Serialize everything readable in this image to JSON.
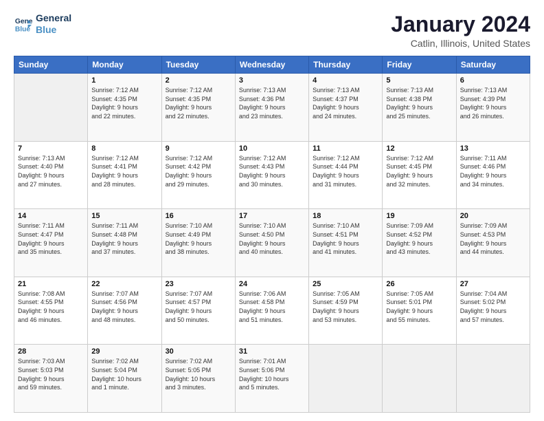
{
  "logo": {
    "line1": "General",
    "line2": "Blue"
  },
  "header": {
    "title": "January 2024",
    "subtitle": "Catlin, Illinois, United States"
  },
  "weekdays": [
    "Sunday",
    "Monday",
    "Tuesday",
    "Wednesday",
    "Thursday",
    "Friday",
    "Saturday"
  ],
  "weeks": [
    [
      {
        "day": "",
        "info": ""
      },
      {
        "day": "1",
        "info": "Sunrise: 7:12 AM\nSunset: 4:35 PM\nDaylight: 9 hours\nand 22 minutes."
      },
      {
        "day": "2",
        "info": "Sunrise: 7:12 AM\nSunset: 4:35 PM\nDaylight: 9 hours\nand 22 minutes."
      },
      {
        "day": "3",
        "info": "Sunrise: 7:13 AM\nSunset: 4:36 PM\nDaylight: 9 hours\nand 23 minutes."
      },
      {
        "day": "4",
        "info": "Sunrise: 7:13 AM\nSunset: 4:37 PM\nDaylight: 9 hours\nand 24 minutes."
      },
      {
        "day": "5",
        "info": "Sunrise: 7:13 AM\nSunset: 4:38 PM\nDaylight: 9 hours\nand 25 minutes."
      },
      {
        "day": "6",
        "info": "Sunrise: 7:13 AM\nSunset: 4:39 PM\nDaylight: 9 hours\nand 26 minutes."
      }
    ],
    [
      {
        "day": "7",
        "info": "Sunrise: 7:13 AM\nSunset: 4:40 PM\nDaylight: 9 hours\nand 27 minutes."
      },
      {
        "day": "8",
        "info": "Sunrise: 7:12 AM\nSunset: 4:41 PM\nDaylight: 9 hours\nand 28 minutes."
      },
      {
        "day": "9",
        "info": "Sunrise: 7:12 AM\nSunset: 4:42 PM\nDaylight: 9 hours\nand 29 minutes."
      },
      {
        "day": "10",
        "info": "Sunrise: 7:12 AM\nSunset: 4:43 PM\nDaylight: 9 hours\nand 30 minutes."
      },
      {
        "day": "11",
        "info": "Sunrise: 7:12 AM\nSunset: 4:44 PM\nDaylight: 9 hours\nand 31 minutes."
      },
      {
        "day": "12",
        "info": "Sunrise: 7:12 AM\nSunset: 4:45 PM\nDaylight: 9 hours\nand 32 minutes."
      },
      {
        "day": "13",
        "info": "Sunrise: 7:11 AM\nSunset: 4:46 PM\nDaylight: 9 hours\nand 34 minutes."
      }
    ],
    [
      {
        "day": "14",
        "info": "Sunrise: 7:11 AM\nSunset: 4:47 PM\nDaylight: 9 hours\nand 35 minutes."
      },
      {
        "day": "15",
        "info": "Sunrise: 7:11 AM\nSunset: 4:48 PM\nDaylight: 9 hours\nand 37 minutes."
      },
      {
        "day": "16",
        "info": "Sunrise: 7:10 AM\nSunset: 4:49 PM\nDaylight: 9 hours\nand 38 minutes."
      },
      {
        "day": "17",
        "info": "Sunrise: 7:10 AM\nSunset: 4:50 PM\nDaylight: 9 hours\nand 40 minutes."
      },
      {
        "day": "18",
        "info": "Sunrise: 7:10 AM\nSunset: 4:51 PM\nDaylight: 9 hours\nand 41 minutes."
      },
      {
        "day": "19",
        "info": "Sunrise: 7:09 AM\nSunset: 4:52 PM\nDaylight: 9 hours\nand 43 minutes."
      },
      {
        "day": "20",
        "info": "Sunrise: 7:09 AM\nSunset: 4:53 PM\nDaylight: 9 hours\nand 44 minutes."
      }
    ],
    [
      {
        "day": "21",
        "info": "Sunrise: 7:08 AM\nSunset: 4:55 PM\nDaylight: 9 hours\nand 46 minutes."
      },
      {
        "day": "22",
        "info": "Sunrise: 7:07 AM\nSunset: 4:56 PM\nDaylight: 9 hours\nand 48 minutes."
      },
      {
        "day": "23",
        "info": "Sunrise: 7:07 AM\nSunset: 4:57 PM\nDaylight: 9 hours\nand 50 minutes."
      },
      {
        "day": "24",
        "info": "Sunrise: 7:06 AM\nSunset: 4:58 PM\nDaylight: 9 hours\nand 51 minutes."
      },
      {
        "day": "25",
        "info": "Sunrise: 7:05 AM\nSunset: 4:59 PM\nDaylight: 9 hours\nand 53 minutes."
      },
      {
        "day": "26",
        "info": "Sunrise: 7:05 AM\nSunset: 5:01 PM\nDaylight: 9 hours\nand 55 minutes."
      },
      {
        "day": "27",
        "info": "Sunrise: 7:04 AM\nSunset: 5:02 PM\nDaylight: 9 hours\nand 57 minutes."
      }
    ],
    [
      {
        "day": "28",
        "info": "Sunrise: 7:03 AM\nSunset: 5:03 PM\nDaylight: 9 hours\nand 59 minutes."
      },
      {
        "day": "29",
        "info": "Sunrise: 7:02 AM\nSunset: 5:04 PM\nDaylight: 10 hours\nand 1 minute."
      },
      {
        "day": "30",
        "info": "Sunrise: 7:02 AM\nSunset: 5:05 PM\nDaylight: 10 hours\nand 3 minutes."
      },
      {
        "day": "31",
        "info": "Sunrise: 7:01 AM\nSunset: 5:06 PM\nDaylight: 10 hours\nand 5 minutes."
      },
      {
        "day": "",
        "info": ""
      },
      {
        "day": "",
        "info": ""
      },
      {
        "day": "",
        "info": ""
      }
    ]
  ]
}
